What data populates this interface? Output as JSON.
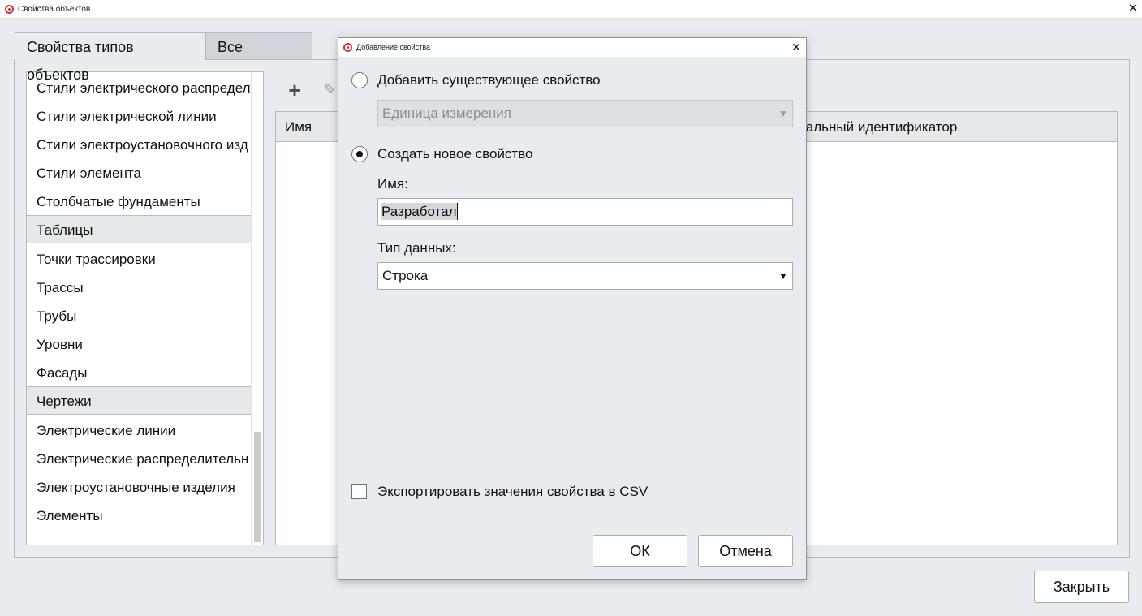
{
  "window": {
    "title": "Свойства объектов",
    "close_glyph": "✕"
  },
  "tabs": [
    {
      "label": "Свойства типов объектов",
      "active": true
    },
    {
      "label": "Все свойства",
      "active": false
    }
  ],
  "left_list": {
    "items": [
      {
        "label": "Стили электрического распредел",
        "group": false
      },
      {
        "label": "Стили электрической линии",
        "group": false
      },
      {
        "label": "Стили электроустановочного изд",
        "group": false
      },
      {
        "label": "Стили элемента",
        "group": false
      },
      {
        "label": "Столбчатые фундаменты",
        "group": false
      },
      {
        "label": "Таблицы",
        "group": true
      },
      {
        "label": "Точки трассировки",
        "group": false
      },
      {
        "label": "Трассы",
        "group": false
      },
      {
        "label": "Трубы",
        "group": false
      },
      {
        "label": "Уровни",
        "group": false
      },
      {
        "label": "Фасады",
        "group": false
      },
      {
        "label": "Чертежи",
        "group": true
      },
      {
        "label": "Электрические линии",
        "group": false
      },
      {
        "label": "Электрические распределительн",
        "group": false
      },
      {
        "label": "Электроустановочные изделия",
        "group": false
      },
      {
        "label": "Элементы",
        "group": false
      }
    ]
  },
  "toolbar": {
    "add_glyph": "+",
    "edit_glyph": "✎"
  },
  "table": {
    "headers": [
      "Имя",
      "кальный идентификатор"
    ]
  },
  "footer": {
    "close_label": "Закрыть"
  },
  "dialog": {
    "title": "Добавление свойства",
    "close_glyph": "✕",
    "option_existing_label": "Добавить существующее свойство",
    "option_existing_checked": false,
    "existing_combo_value": "Единица измерения",
    "option_new_label": "Создать новое свойство",
    "option_new_checked": true,
    "name_label": "Имя:",
    "name_value": "Разработал",
    "type_label": "Тип данных:",
    "type_value": "Строка",
    "combo_arrow_glyph": "▼",
    "export_label": "Экспортировать значения свойства в CSV",
    "export_checked": false,
    "ok_label": "ОК",
    "cancel_label": "Отмена"
  },
  "colors": {
    "background": "#e8ecf0",
    "app_icon": "#d2343c"
  }
}
